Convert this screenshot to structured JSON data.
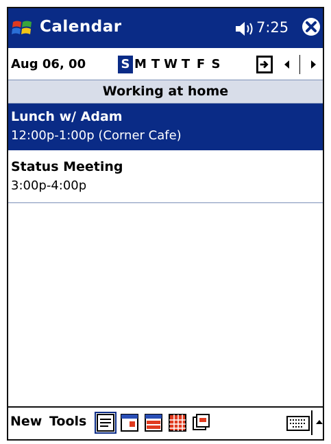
{
  "titlebar": {
    "app_title": "Calendar",
    "time": "7:25",
    "start_icon": "windows-flag-icon",
    "volume_icon": "speaker-icon",
    "close_icon": "close-icon"
  },
  "datebar": {
    "date": "Aug 06, 00",
    "days": [
      "S",
      "M",
      "T",
      "W",
      "T",
      "F",
      "S"
    ],
    "selected_day_index": 0,
    "goto_today_icon": "goto-today-icon",
    "prev_icon": "arrow-left-icon",
    "next_icon": "arrow-right-icon"
  },
  "allday_event": "Working at home",
  "appointments": [
    {
      "title": "Lunch w/ Adam",
      "time": "12:00p-1:00p (Corner Cafe)"
    },
    {
      "title": "Status Meeting",
      "time": "3:00p-4:00p"
    }
  ],
  "toolbar": {
    "new_label": "New",
    "tools_label": "Tools",
    "views": [
      "agenda-view-icon",
      "day-view-icon",
      "week-view-icon",
      "month-view-icon",
      "year-view-icon"
    ],
    "active_view_index": 0,
    "keyboard_icon": "keyboard-icon",
    "sip_arrow_icon": "sip-up-arrow-icon"
  },
  "colors": {
    "title_bg": "#0a2b86",
    "selection_bg": "#0a2b86",
    "allday_bg": "#d8dde9"
  }
}
